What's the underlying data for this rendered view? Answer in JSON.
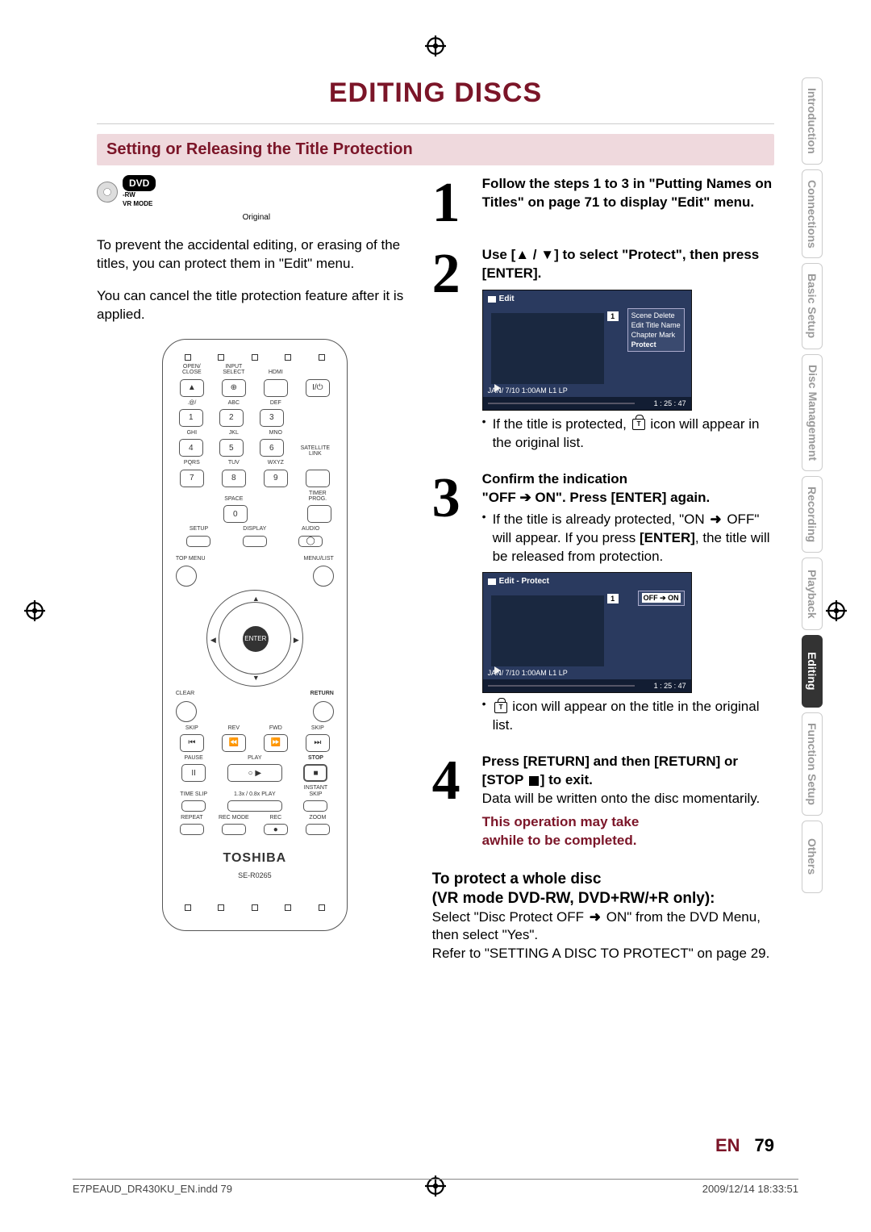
{
  "title": "EDITING DISCS",
  "section_heading": "Setting or Releasing the Title Protection",
  "dvd_badge": "DVD",
  "dvd_sublines": [
    "-RW",
    "VR MODE"
  ],
  "dvd_caption": "Original",
  "intro_p1": "To prevent the accidental editing, or erasing of the titles, you can protect them in \"Edit\" menu.",
  "intro_p2": "You can cancel the title protection feature after it is applied.",
  "remote": {
    "labels_row1": [
      "OPEN/ CLOSE",
      "INPUT SELECT",
      "HDMI",
      ""
    ],
    "keypad_labels": [
      ".@/",
      "ABC",
      "DEF",
      "GHI",
      "JKL",
      "MNO",
      "PQRS",
      "TUV",
      "WXYZ",
      "",
      "SPACE",
      ""
    ],
    "keypad_nums": [
      "1",
      "2",
      "3",
      "4",
      "5",
      "6",
      "7",
      "8",
      "9",
      "",
      "0",
      ""
    ],
    "side_labels": [
      "SATELLITE LINK",
      "TIMER PROG."
    ],
    "row_sda": [
      "SETUP",
      "DISPLAY",
      "AUDIO"
    ],
    "top_menu": "TOP MENU",
    "menu_list": "MENU/LIST",
    "enter": "ENTER",
    "clear": "CLEAR",
    "return": "RETURN",
    "transport_labels": [
      "SKIP",
      "REV",
      "FWD",
      "SKIP",
      "PAUSE",
      "PLAY",
      "",
      "STOP"
    ],
    "row_slip": [
      "TIME SLIP",
      "1.3x / 0.8x PLAY",
      "INSTANT SKIP"
    ],
    "row_rep": [
      "REPEAT",
      "REC MODE",
      "REC",
      "ZOOM"
    ],
    "brand": "TOSHIBA",
    "model": "SE-R0265"
  },
  "steps": [
    {
      "n": "1",
      "head": "Follow the steps 1 to 3 in \"Putting Names on Titles\" on page 71 to display \"Edit\" menu."
    },
    {
      "n": "2",
      "head_pre": "Use [",
      "head_between": " / ",
      "head_post": "] to select \"Protect\", then press [ENTER].",
      "ui": {
        "title": "Edit",
        "idx": "1",
        "menu": [
          "Scene Delete",
          "Edit Title Name",
          "Chapter Mark",
          "Protect"
        ],
        "foot": "JAN/ 7/10 1:00AM L1   LP",
        "time": "1 : 25 : 47"
      },
      "bullet": " If the title is protected, ",
      "bullet_post": " icon will appear in the original list."
    },
    {
      "n": "3",
      "head_line1": "Confirm the indication",
      "head_line2": "\"OFF ➔ ON\". Press [ENTER] again.",
      "bullet1_pre": " If the title is already protected, \"ON ",
      "bullet1_post": " OFF\" will appear. If you press ",
      "bullet1_bold": "[ENTER]",
      "bullet1_end": ", the title will be released from protection.",
      "ui": {
        "title": "Edit - Protect",
        "idx": "1",
        "toggle": "OFF ➔ ON",
        "foot": "JAN/ 7/10 1:00AM L1   LP",
        "time": "1 : 25 : 47"
      },
      "bullet2_pre": " ",
      "bullet2_post": " icon will appear on the title in the original list."
    },
    {
      "n": "4",
      "head": "Press [RETURN] and then [RETURN] or [STOP ",
      "head_post": "] to exit.",
      "body": "Data will be written onto the disc momentarily.",
      "note1": "This operation may take",
      "note2": "awhile to be completed."
    }
  ],
  "whole_disc": {
    "heading1": "To protect a whole disc",
    "heading2": "(VR mode DVD-RW, DVD+RW/+R only):",
    "body1_pre": "Select \"Disc Protect OFF ",
    "body1_post": " ON\" from the DVD Menu, then select \"Yes\".",
    "body2": "Refer to \"SETTING A DISC TO PROTECT\" on page 29."
  },
  "tabs": [
    "Introduction",
    "Connections",
    "Basic Setup",
    "Disc Management",
    "Recording",
    "Playback",
    "Editing",
    "Function Setup",
    "Others"
  ],
  "active_tab": "Editing",
  "page_lang": "EN",
  "page_num": "79",
  "foot_file": "E7PEAUD_DR430KU_EN.indd   79",
  "foot_date": "2009/12/14   18:33:51"
}
